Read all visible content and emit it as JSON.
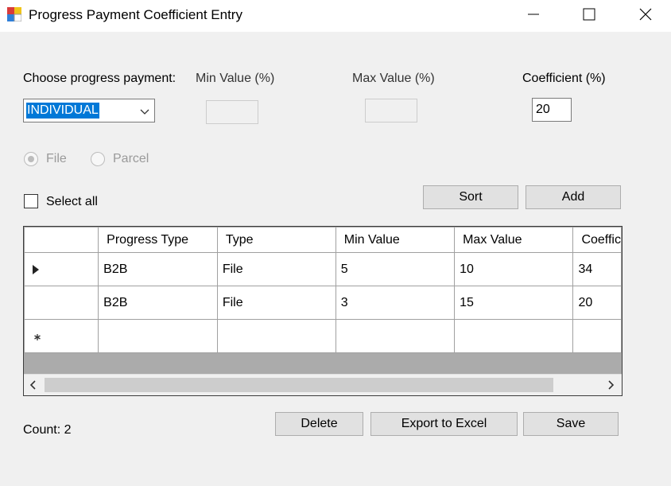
{
  "window": {
    "title": "Progress Payment Coefficient Entry"
  },
  "form": {
    "choose_label": "Choose progress payment:",
    "choose_value": "INDIVIDUAL",
    "min_label": "Min Value (%)",
    "min_value": "",
    "max_label": "Max Value (%)",
    "max_value": "",
    "coef_label": "Coefficient (%)",
    "coef_value": "20",
    "radio_file": "File",
    "radio_parcel": "Parcel",
    "select_all": "Select all",
    "sort_button": "Sort",
    "add_button": "Add"
  },
  "grid": {
    "columns": [
      "Progress Type",
      "Type",
      "Min Value",
      "Max Value",
      "Coeffic"
    ],
    "rows": [
      [
        "B2B",
        "File",
        "5",
        "10",
        "34"
      ],
      [
        "B2B",
        "File",
        "3",
        "15",
        "20"
      ]
    ]
  },
  "footer": {
    "count": "Count: 2",
    "delete_button": "Delete",
    "export_button": "Export to Excel",
    "save_button": "Save"
  }
}
